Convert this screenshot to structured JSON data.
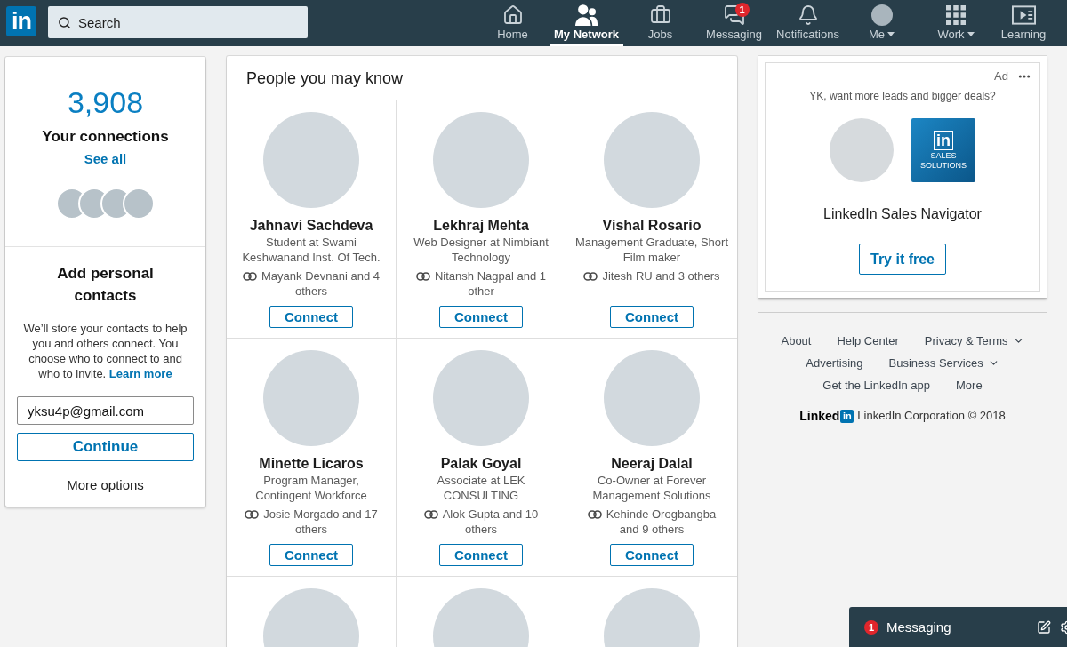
{
  "nav": {
    "logo": "in",
    "search": {
      "placeholder": "Search"
    },
    "main_items": [
      {
        "label": "Home",
        "selected": false,
        "dropdown": false
      },
      {
        "label": "My Network",
        "selected": true,
        "dropdown": false
      },
      {
        "label": "Jobs",
        "selected": false,
        "dropdown": false
      },
      {
        "label": "Messaging",
        "selected": false,
        "dropdown": false,
        "badge": "1"
      },
      {
        "label": "Notifications",
        "selected": false,
        "dropdown": false
      },
      {
        "label": "Me",
        "selected": false,
        "dropdown": true
      }
    ],
    "side_items": [
      {
        "label": "Work",
        "selected": false,
        "dropdown": true
      },
      {
        "label": "Learning",
        "selected": false,
        "dropdown": false
      }
    ]
  },
  "connections": {
    "count": "3,908",
    "label": "Your connections",
    "link": "See all"
  },
  "contacts": {
    "title": "Add personal contacts",
    "text": "We’ll store your contacts to help you and others connect. You choose who to connect to and who to invite.",
    "link": "Learn more",
    "email": {
      "value": "yksu4p@gmail.com"
    },
    "button": "Continue",
    "more": "More options"
  },
  "people": {
    "title": "People you may know",
    "cards": [
      {
        "kind": "full",
        "name": "Jahnavi Sachdeva",
        "headline": "Student at Swami Keshwanand Inst. Of Tech.",
        "mutual": "Mayank Devnani and 4 others",
        "button": "Connect"
      },
      {
        "kind": "full",
        "name": "Lekhraj Mehta",
        "headline": "Web Designer at Nimbiant Technology",
        "mutual": "Nitansh Nagpal and 1 other",
        "button": "Connect"
      },
      {
        "kind": "full",
        "name": "Vishal Rosario",
        "headline": "Management Graduate, Short Film maker",
        "mutual": "Jitesh RU and 3 others",
        "button": "Connect"
      },
      {
        "kind": "full",
        "name": "Minette Licaros",
        "headline": "Program Manager, Contingent Workforce",
        "mutual": "Josie Morgado and 17 others",
        "button": "Connect"
      },
      {
        "kind": "full",
        "name": "Palak Goyal",
        "headline": "Associate at LEK CONSULTING",
        "mutual": "Alok Gupta and 10 others",
        "button": "Connect"
      },
      {
        "kind": "full",
        "name": "Neeraj Dalal",
        "headline": "Co-Owner at Forever Management Solutions",
        "mutual": "Kehinde Orogbangba and 9 others",
        "button": "Connect"
      },
      {
        "kind": "partial"
      },
      {
        "kind": "partial"
      },
      {
        "kind": "partial"
      }
    ]
  },
  "ad": {
    "label": "Ad",
    "headline": "YK, want more leads and bigger deals?",
    "tile": {
      "logo": "in",
      "lines": [
        "SALES",
        "SOLUTIONS"
      ]
    },
    "title": "LinkedIn Sales Navigator",
    "button": "Try it free"
  },
  "footer": {
    "link_rows": [
      [
        {
          "label": "About",
          "dropdown": false
        },
        {
          "label": "Help Center",
          "dropdown": false
        },
        {
          "label": "Privacy & Terms",
          "dropdown": true
        }
      ],
      [
        {
          "label": "Advertising",
          "dropdown": false
        },
        {
          "label": "Business Services",
          "dropdown": true
        }
      ],
      [
        {
          "label": "Get the LinkedIn app",
          "dropdown": false
        },
        {
          "label": "More",
          "dropdown": false
        }
      ]
    ],
    "brand": {
      "word": "Linked",
      "mark": "in"
    },
    "copyright": "LinkedIn Corporation © 2018"
  },
  "messaging_bar": {
    "badge": "1",
    "label": "Messaging"
  }
}
